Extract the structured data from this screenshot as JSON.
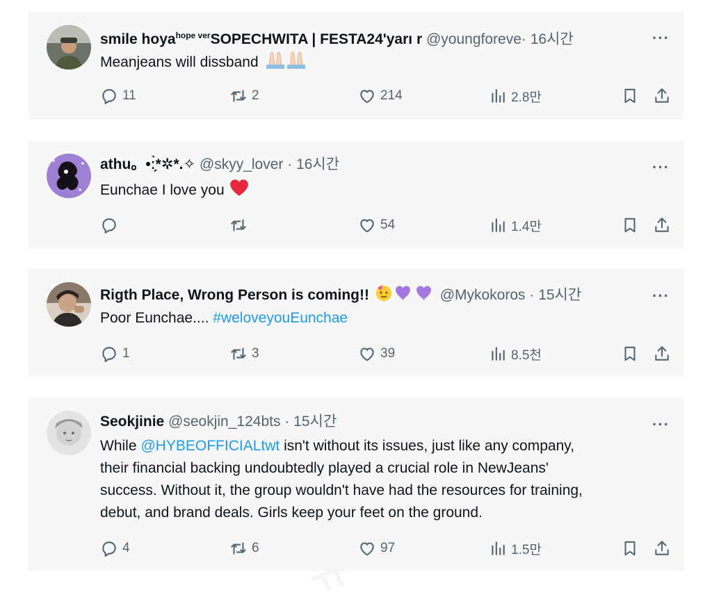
{
  "tweets": [
    {
      "name": "smile hoya",
      "name_sup": "hope ver",
      "name_rest": "SOPECHWITA | FESTA24'yarı r",
      "handle": "@youngforeve",
      "time": "· 16시간",
      "text": "Meanjeans will dissband",
      "emoji": "praying-hands-icon",
      "replies": "11",
      "retweets": "2",
      "likes": "214",
      "views": "2.8만"
    },
    {
      "name": "athu。•ː̗̀*✲*.✧",
      "handle": "@skyy_lover",
      "time": "· 16시간",
      "text": "Eunchae I love you",
      "emoji": "red-heart-icon",
      "replies": "",
      "retweets": "",
      "likes": "54",
      "views": "1.4만"
    },
    {
      "name": "Rigth Place, Wrong Person is coming!!",
      "emoji": "party-face-purple-hearts-icon",
      "handle": "@Mykokoros",
      "time": "· 15시간",
      "text": "Poor Eunchae....",
      "hashtag": "#weloveyouEunchae",
      "replies": "1",
      "retweets": "3",
      "likes": "39",
      "views": "8.5천"
    },
    {
      "name": "Seokjinie",
      "handle": "@seokjin_124bts",
      "time": "· 15시간",
      "text_pre": "While",
      "mention": "@HYBEOFFICIALtwt",
      "text_post": "isn't without its issues, just like any company,",
      "lines": [
        "their financial backing undoubtedly played a crucial role in NewJeans'",
        "success. Without it, the group wouldn't have had the resources for training,",
        "debut, and brand deals. Girls keep your feet on the ground."
      ],
      "replies": "4",
      "retweets": "6",
      "likes": "97",
      "views": "1.5만"
    }
  ],
  "colors": {
    "text": "#0f1419",
    "muted": "#536471",
    "link": "#1d9bf0",
    "card": "#f7f7f8"
  }
}
